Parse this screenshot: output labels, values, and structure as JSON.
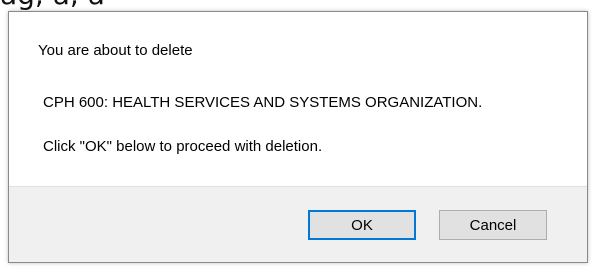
{
  "background": {
    "fragment_text": "ag, a, a"
  },
  "dialog": {
    "line1": "You are about to delete",
    "line2": "CPH 600: HEALTH SERVICES AND SYSTEMS ORGANIZATION.",
    "line3": "Click \"OK\" below to proceed with deletion.",
    "ok_label": "OK",
    "cancel_label": "Cancel"
  },
  "colors": {
    "focus_border": "#0078d7",
    "button_bg": "#e1e1e1",
    "footer_bg": "#f0f0f0"
  }
}
